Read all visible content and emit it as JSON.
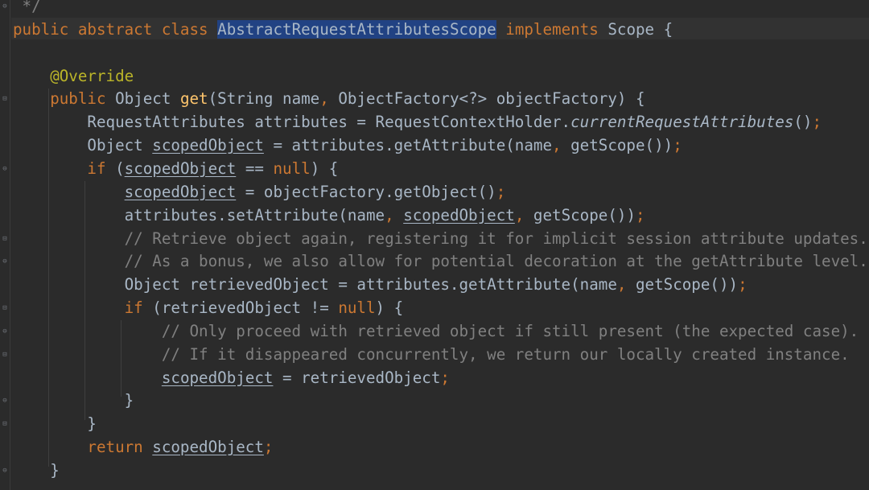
{
  "editor": {
    "colors": {
      "background": "#2b2b2b",
      "current_line": "#323232",
      "keyword": "#cc7832",
      "identifier": "#a9b7c6",
      "method": "#ffc66d",
      "annotation": "#bbb529",
      "comment": "#808080",
      "selection": "#214283"
    },
    "lines": [
      {
        "segments": [
          {
            "text": " */",
            "kind": "com"
          }
        ]
      },
      {
        "segments": [
          {
            "text": "public abstract class ",
            "kind": "kw"
          },
          {
            "text": "AbstractRequestAttributesScope",
            "kind": "sel"
          },
          {
            "text": " implements ",
            "kind": "kw"
          },
          {
            "text": "Scope {",
            "kind": "id"
          }
        ]
      },
      {
        "segments": []
      },
      {
        "segments": [
          {
            "text": "    @Override",
            "kind": "ann"
          }
        ]
      },
      {
        "segments": [
          {
            "text": "    public ",
            "kind": "kw"
          },
          {
            "text": "Object ",
            "kind": "id"
          },
          {
            "text": "get",
            "kind": "method"
          },
          {
            "text": "(String name",
            "kind": "id"
          },
          {
            "text": ", ",
            "kind": "punct"
          },
          {
            "text": "ObjectFactory<?> objectFactory) {",
            "kind": "id"
          }
        ]
      },
      {
        "segments": [
          {
            "text": "        RequestAttributes attributes = RequestContextHolder.",
            "kind": "id"
          },
          {
            "text": "currentRequestAttributes",
            "kind": "static"
          },
          {
            "text": "()",
            "kind": "id"
          },
          {
            "text": ";",
            "kind": "punct"
          }
        ]
      },
      {
        "segments": [
          {
            "text": "        Object ",
            "kind": "id"
          },
          {
            "text": "scopedObject",
            "kind": "var"
          },
          {
            "text": " = attributes.getAttribute(name",
            "kind": "id"
          },
          {
            "text": ", ",
            "kind": "punct"
          },
          {
            "text": "getScope())",
            "kind": "id"
          },
          {
            "text": ";",
            "kind": "punct"
          }
        ]
      },
      {
        "segments": [
          {
            "text": "        if ",
            "kind": "kw"
          },
          {
            "text": "(",
            "kind": "id"
          },
          {
            "text": "scopedObject",
            "kind": "var"
          },
          {
            "text": " == ",
            "kind": "id"
          },
          {
            "text": "null",
            "kind": "kw"
          },
          {
            "text": ") {",
            "kind": "id"
          }
        ]
      },
      {
        "segments": [
          {
            "text": "            ",
            "kind": "id"
          },
          {
            "text": "scopedObject",
            "kind": "var"
          },
          {
            "text": " = objectFactory.getObject()",
            "kind": "id"
          },
          {
            "text": ";",
            "kind": "punct"
          }
        ]
      },
      {
        "segments": [
          {
            "text": "            attributes.setAttribute(name",
            "kind": "id"
          },
          {
            "text": ", ",
            "kind": "punct"
          },
          {
            "text": "scopedObject",
            "kind": "var"
          },
          {
            "text": ", ",
            "kind": "punct"
          },
          {
            "text": "getScope())",
            "kind": "id"
          },
          {
            "text": ";",
            "kind": "punct"
          }
        ]
      },
      {
        "segments": [
          {
            "text": "            // Retrieve object again, registering it for implicit session attribute updates.",
            "kind": "com"
          }
        ]
      },
      {
        "segments": [
          {
            "text": "            // As a bonus, we also allow for potential decoration at the getAttribute level.",
            "kind": "com"
          }
        ]
      },
      {
        "segments": [
          {
            "text": "            Object retrievedObject = attributes.getAttribute(name",
            "kind": "id"
          },
          {
            "text": ", ",
            "kind": "punct"
          },
          {
            "text": "getScope())",
            "kind": "id"
          },
          {
            "text": ";",
            "kind": "punct"
          }
        ]
      },
      {
        "segments": [
          {
            "text": "            if ",
            "kind": "kw"
          },
          {
            "text": "(retrievedObject != ",
            "kind": "id"
          },
          {
            "text": "null",
            "kind": "kw"
          },
          {
            "text": ") {",
            "kind": "id"
          }
        ]
      },
      {
        "segments": [
          {
            "text": "                // Only proceed with retrieved object if still present (the expected case).",
            "kind": "com"
          }
        ]
      },
      {
        "segments": [
          {
            "text": "                // If it disappeared concurrently, we return our locally created instance.",
            "kind": "com"
          }
        ]
      },
      {
        "segments": [
          {
            "text": "                ",
            "kind": "id"
          },
          {
            "text": "scopedObject",
            "kind": "var"
          },
          {
            "text": " = retrievedObject",
            "kind": "id"
          },
          {
            "text": ";",
            "kind": "punct"
          }
        ]
      },
      {
        "segments": [
          {
            "text": "            }",
            "kind": "id"
          }
        ]
      },
      {
        "segments": [
          {
            "text": "        }",
            "kind": "id"
          }
        ]
      },
      {
        "segments": [
          {
            "text": "        return ",
            "kind": "kw"
          },
          {
            "text": "scopedObject",
            "kind": "var"
          },
          {
            "text": ";",
            "kind": "punct"
          }
        ]
      },
      {
        "segments": [
          {
            "text": "    }",
            "kind": "id"
          }
        ]
      }
    ],
    "fold_markers": [
      {
        "icon": "fold-close-icon",
        "glyph": "⊖"
      },
      {
        "icon": "fold-open-icon",
        "glyph": "⊟"
      }
    ]
  }
}
